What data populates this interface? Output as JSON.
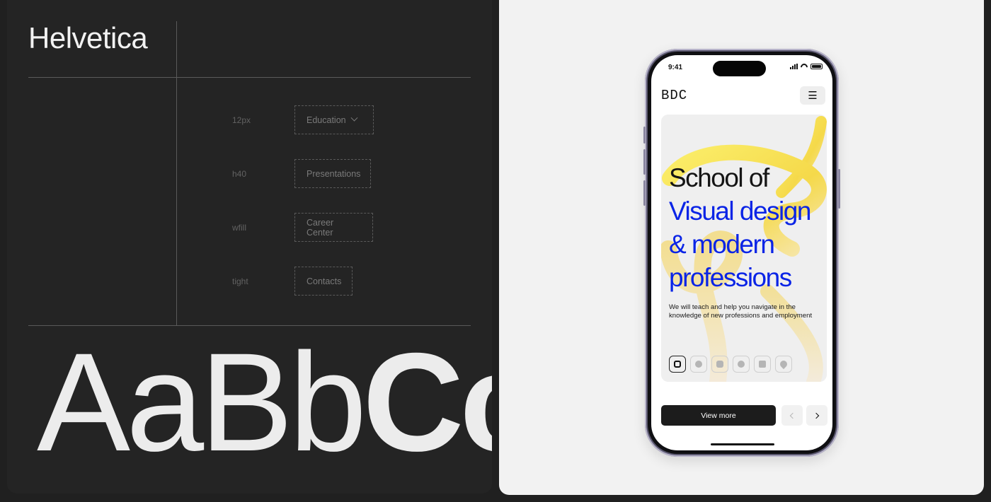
{
  "left_panel": {
    "font_name": "Helvetica",
    "specs": [
      {
        "label": "12px",
        "item": "Education",
        "has_chevron": true
      },
      {
        "label": "h40",
        "item": "Presentations",
        "has_chevron": false
      },
      {
        "label": "wfill",
        "item": "Career Center",
        "has_chevron": false
      },
      {
        "label": "tight",
        "item": "Contacts",
        "has_chevron": false
      }
    ],
    "specimen_regular": "AaBb",
    "specimen_bold": "Cc"
  },
  "phone": {
    "status_time": "9:41",
    "logo": "BDC",
    "menu_icon": "☰",
    "hero": {
      "title_line1": "School of",
      "title_line2": "Visual design",
      "title_line3": "& modern",
      "title_line4": "professions",
      "description": "We will teach and help you navigate in the knowledge of new professions and employment"
    },
    "socials": [
      "instagram-icon",
      "facebook-icon",
      "youtube-icon",
      "whatsapp-icon",
      "linkedin-icon",
      "location-icon"
    ],
    "cta_label": "View more",
    "colors": {
      "accent_blue": "#0a24e6",
      "button_dark": "#1c1c1c",
      "art_yellow": "#f5e04a"
    }
  }
}
